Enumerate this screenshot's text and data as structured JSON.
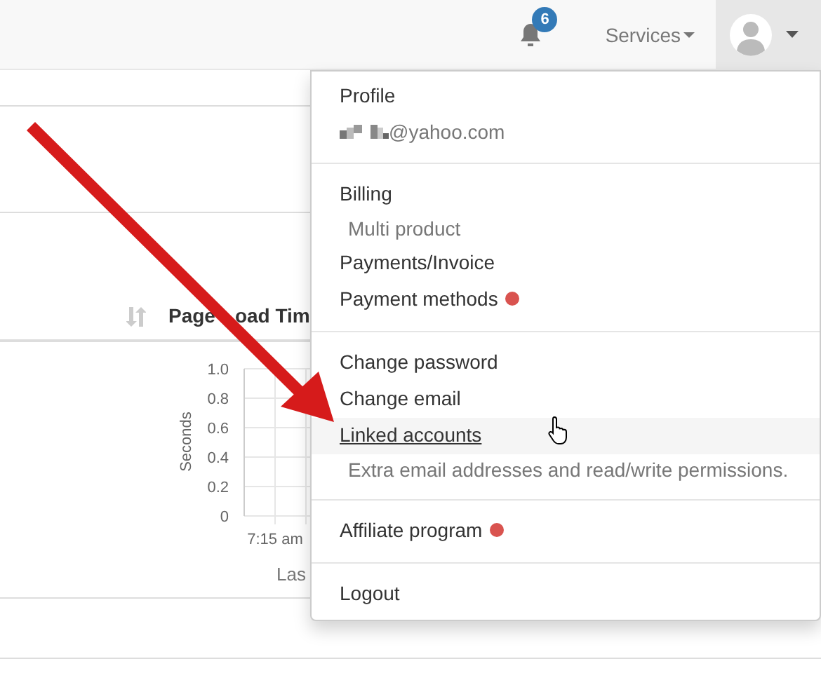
{
  "navbar": {
    "notifications": {
      "count": "6"
    },
    "services": {
      "label": "Services"
    },
    "user_menu": {
      "expanded": true
    }
  },
  "table": {
    "header": {
      "label_parts": [
        "Page",
        "oad Tim"
      ]
    },
    "chart": {
      "ylabel": "Seconds",
      "yticks": [
        "1.0",
        "0.8",
        "0.6",
        "0.4",
        "0.2",
        "0"
      ],
      "xticks": [
        "7:15 am"
      ],
      "xlabel": "Las"
    }
  },
  "dropdown": {
    "sections": [
      {
        "items": [
          {
            "kind": "heading",
            "text": "Profile"
          },
          {
            "kind": "email",
            "text": "@yahoo.com"
          }
        ]
      },
      {
        "items": [
          {
            "kind": "heading",
            "text": "Billing"
          },
          {
            "kind": "note",
            "text": "Multi product"
          },
          {
            "kind": "link",
            "text": "Payments/Invoice",
            "hovered": false
          },
          {
            "kind": "link",
            "text": "Payment methods",
            "hovered": false,
            "color": "#d9534f"
          }
        ]
      },
      {
        "items": [
          {
            "kind": "link",
            "text": "Change password",
            "hovered": false
          },
          {
            "kind": "link",
            "text": "Change email",
            "hovered": false
          },
          {
            "kind": "link",
            "text": "Linked accounts",
            "hovered": true
          },
          {
            "kind": "note",
            "text": "Extra email addresses and read/write permissions."
          }
        ]
      },
      {
        "items": [
          {
            "kind": "link",
            "text": "Affiliate program",
            "hovered": false,
            "color": "#d9534f"
          }
        ]
      },
      {
        "items": [
          {
            "kind": "link",
            "text": "Logout",
            "hovered": false
          }
        ]
      }
    ]
  }
}
